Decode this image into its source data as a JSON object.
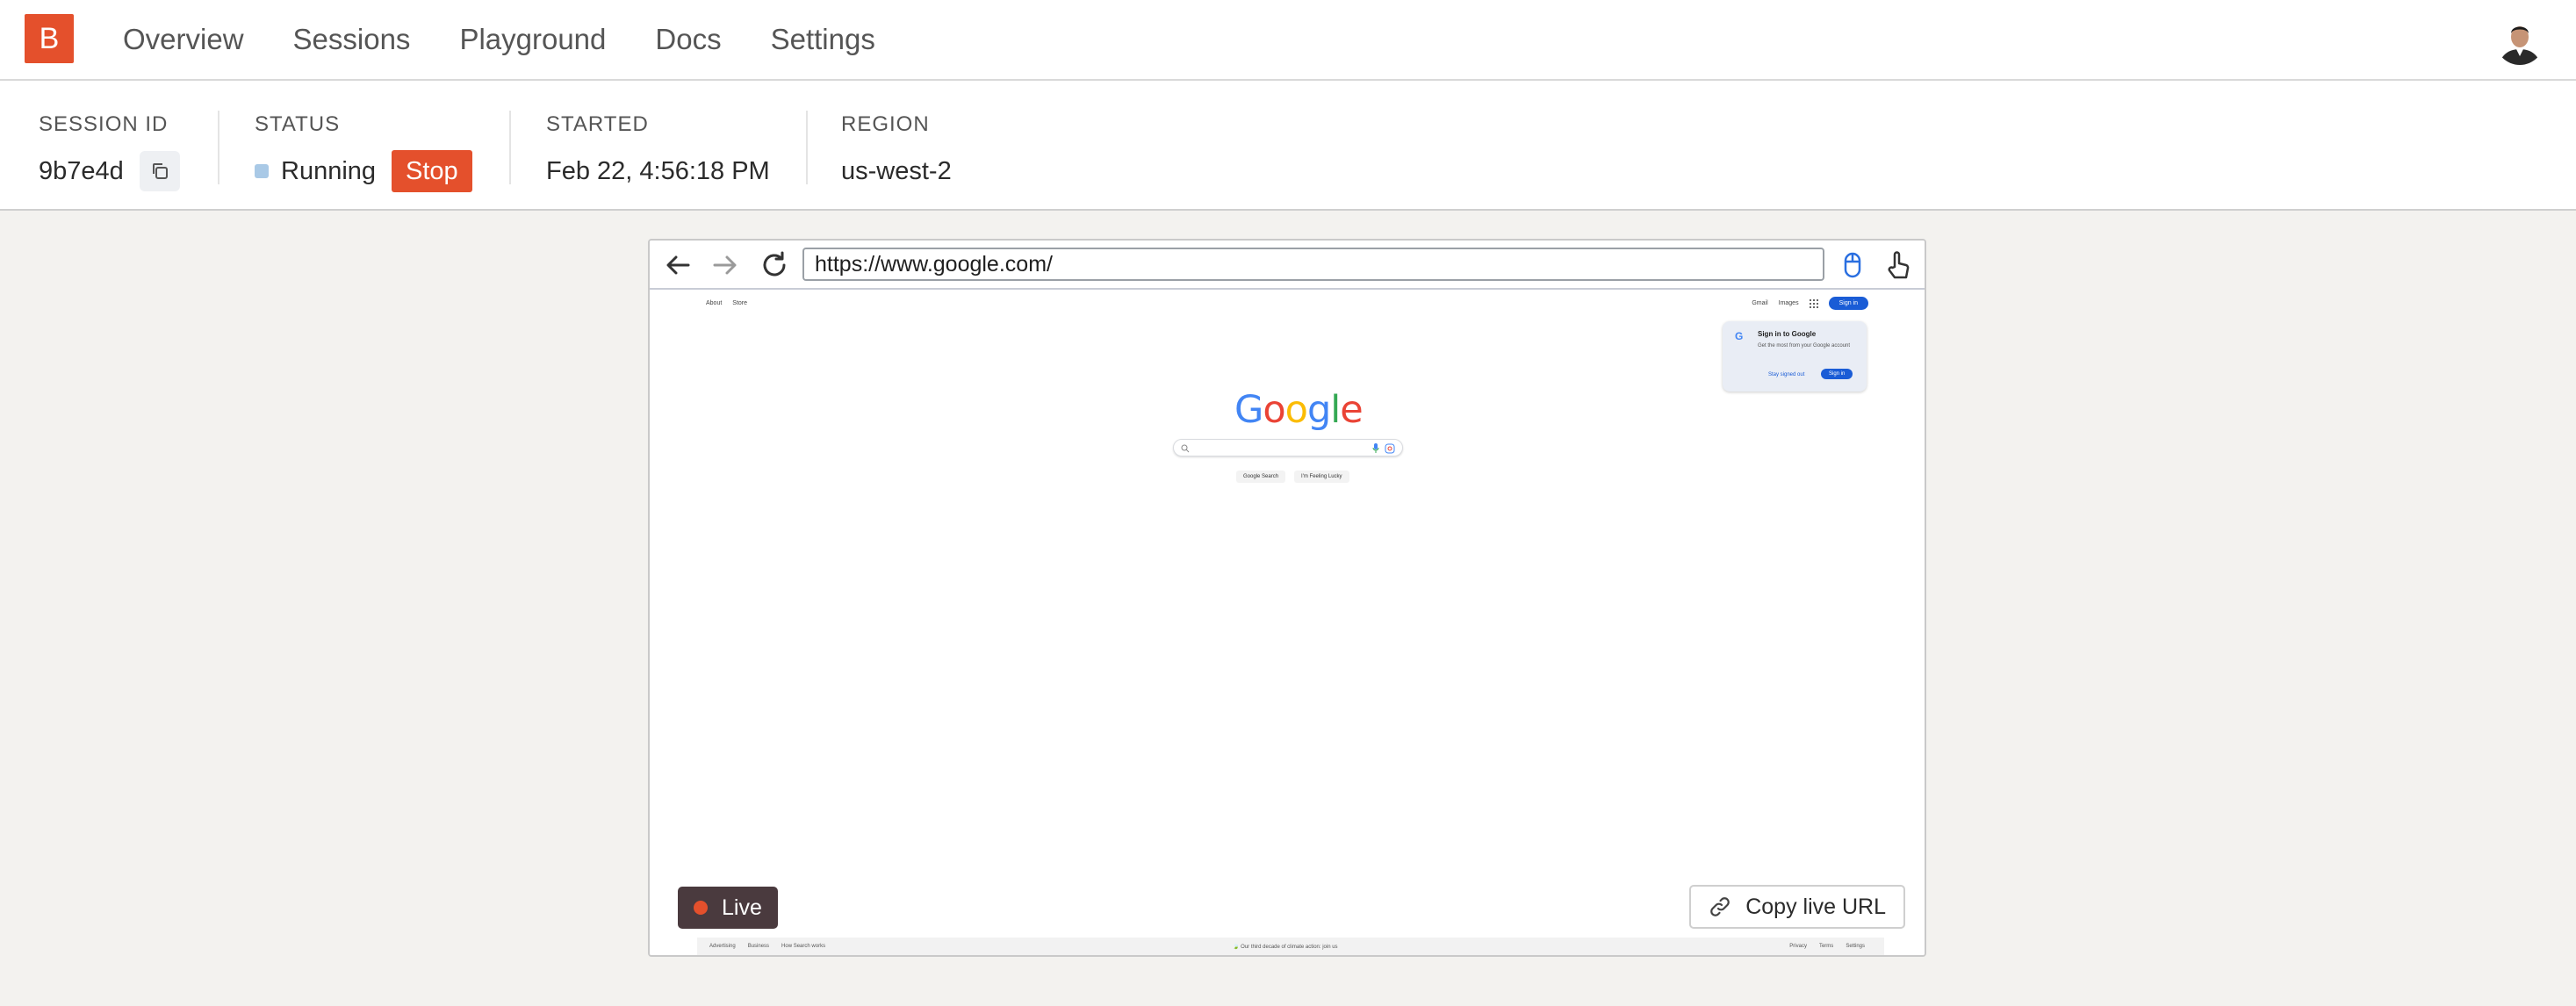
{
  "app": {
    "logo_letter": "B",
    "brand_color": "#e4502c"
  },
  "nav": {
    "items": [
      {
        "label": "Overview"
      },
      {
        "label": "Sessions"
      },
      {
        "label": "Playground"
      },
      {
        "label": "Docs"
      },
      {
        "label": "Settings"
      }
    ]
  },
  "session": {
    "id_label": "SESSION ID",
    "id_value": "9b7e4d",
    "status_label": "STATUS",
    "status_value": "Running",
    "stop_label": "Stop",
    "started_label": "STARTED",
    "started_value": "Feb 22, 4:56:18 PM",
    "region_label": "REGION",
    "region_value": "us-west-2"
  },
  "browser": {
    "url": "https://www.google.com/",
    "live_label": "Live",
    "copy_live_label": "Copy live URL"
  },
  "google": {
    "top_left": [
      "About",
      "Store"
    ],
    "top_right": [
      "Gmail",
      "Images"
    ],
    "sign_in": "Sign in",
    "popup_title": "Sign in to Google",
    "popup_desc": "Get the most from your Google account",
    "popup_stay": "Stay signed out",
    "popup_sign": "Sign in",
    "search_btn": "Google Search",
    "lucky_btn": "I'm Feeling Lucky",
    "footer_left": [
      "Advertising",
      "Business",
      "How Search works"
    ],
    "footer_center": "Our third decade of climate action: join us",
    "footer_right": [
      "Privacy",
      "Terms",
      "Settings"
    ]
  }
}
